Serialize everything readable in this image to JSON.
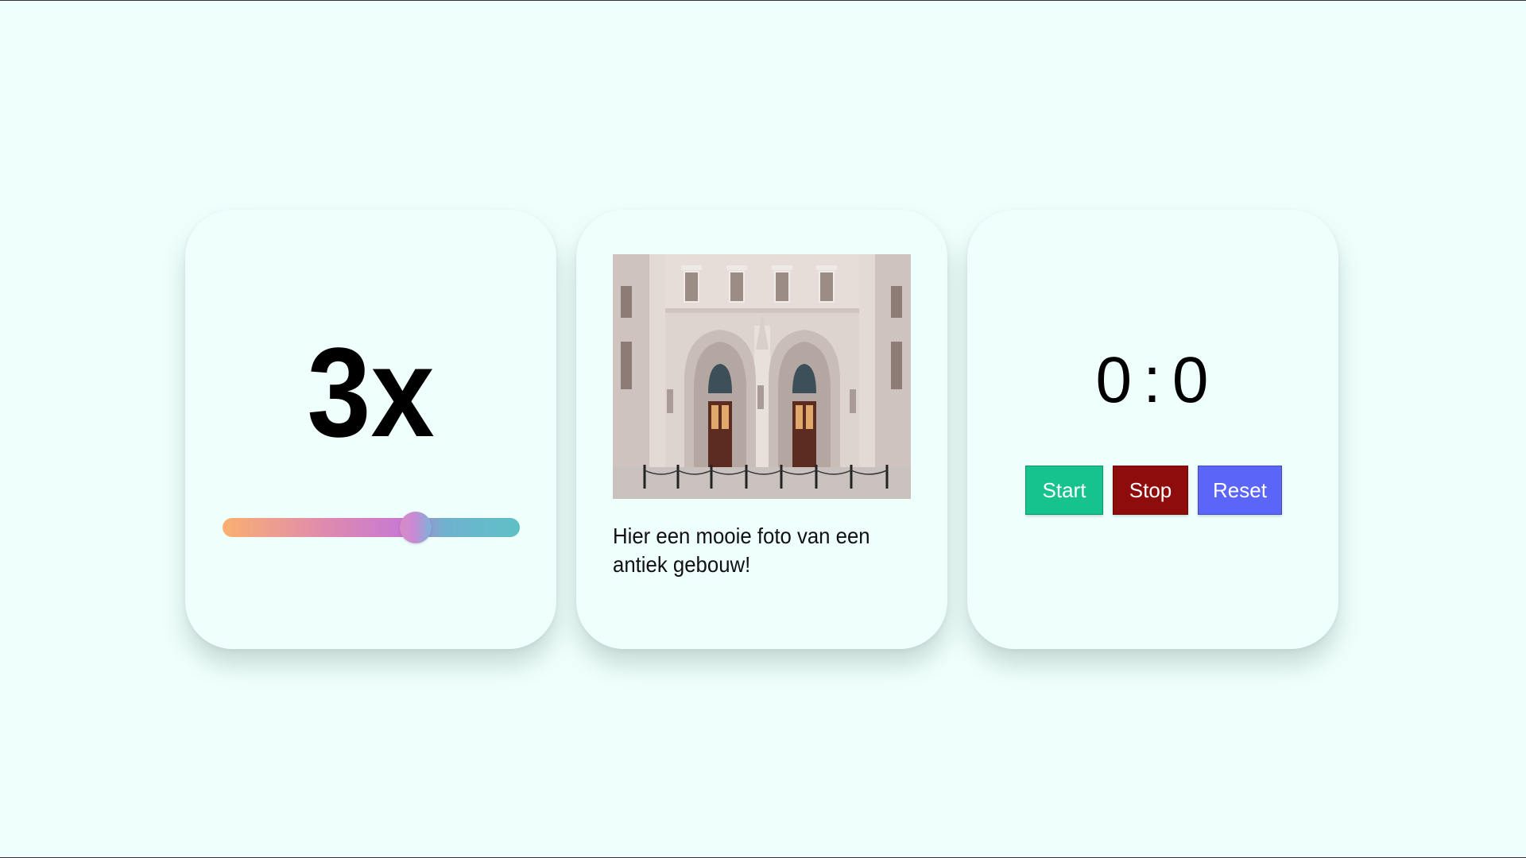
{
  "multiplier_card": {
    "value_text": "3x",
    "slider": {
      "value_fraction": 0.65
    }
  },
  "photo_card": {
    "image": "antique-building-entrance-photo",
    "caption": "Hier een mooie foto van een antiek gebouw!"
  },
  "stopwatch_card": {
    "minutes": "0",
    "separator": ":",
    "seconds": "0",
    "buttons": {
      "start": "Start",
      "stop": "Stop",
      "reset": "Reset"
    },
    "colors": {
      "start": "#16c38f",
      "stop": "#8e0c0c",
      "reset": "#5b65f7"
    }
  },
  "colors": {
    "page_background": "#effffc",
    "slider_gradient": [
      "#f9b070",
      "#c77ad2",
      "#5ec0c6"
    ]
  }
}
